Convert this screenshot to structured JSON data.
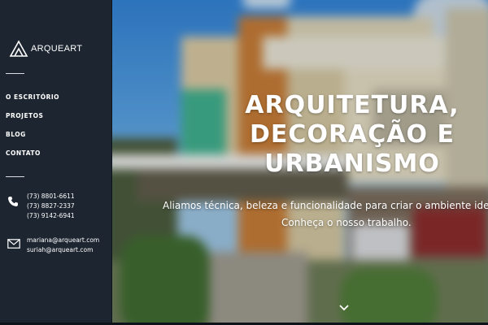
{
  "brand": {
    "name": "ARQUEART",
    "logo_icon": "triangle-logo-icon"
  },
  "nav": {
    "items": [
      {
        "label": "O ESCRITÓRIO"
      },
      {
        "label": "PROJETOS"
      },
      {
        "label": "BLOG"
      },
      {
        "label": "CONTATO"
      }
    ]
  },
  "contact": {
    "phone_icon": "phone-icon",
    "phones": [
      "(73) 8801-6611",
      "(73) 8827-2337",
      "(73) 9142-6941"
    ],
    "email_icon": "envelope-icon",
    "emails": [
      "mariana@arqueart.com",
      "suriah@arqueart.com"
    ]
  },
  "hero": {
    "title_lines": [
      "ARQUITETURA,",
      "DECORAÇÃO E",
      "URBANISMO"
    ],
    "subtitle_lines": [
      "Aliamos técnica, beleza e funcionalidade para criar o ambiente ideal pa",
      "Conheça o nosso trabalho."
    ],
    "scroll_icon": "chevron-down-icon"
  },
  "colors": {
    "sidebar_bg": "#1d2530",
    "text": "#ffffff",
    "sky": "#3d8fd8"
  }
}
